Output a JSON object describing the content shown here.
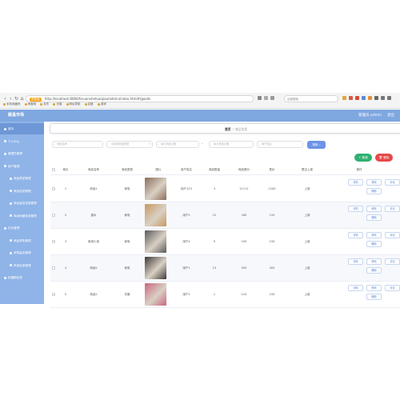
{
  "browser": {
    "url_badge": "不安全",
    "url": "http://localhost:8080/faruanshehuoqiao/admin/index.html#/goods",
    "search_placeholder": "百度搜索",
    "bookmarks": [
      "手机收藏夹",
      "淘宝网",
      "京东",
      "天猫",
      "网址导航",
      "百度",
      "游戏"
    ]
  },
  "app": {
    "title": "跳蚤市场",
    "admin_label": "管理员 admin",
    "logout_label": "退出"
  },
  "sidebar": {
    "items": [
      {
        "label": "首页",
        "active": true,
        "sub": false
      },
      {
        "label": "个人中心",
        "active": false,
        "sub": false
      },
      {
        "label": "管理员管理",
        "active": false,
        "sub": false
      },
      {
        "label": "用户管理",
        "active": false,
        "sub": false
      },
      {
        "label": "商品类型管理",
        "active": false,
        "sub": true
      },
      {
        "label": "商品信息管理",
        "active": false,
        "sub": true
      },
      {
        "label": "商品留言信息管理",
        "active": false,
        "sub": true
      },
      {
        "label": "商品收藏信息管理",
        "active": false,
        "sub": true
      },
      {
        "label": "论坛管理",
        "active": false,
        "sub": false
      },
      {
        "label": "商品求购管理",
        "active": false,
        "sub": true
      },
      {
        "label": "求购留言管理",
        "active": false,
        "sub": true
      },
      {
        "label": "系统信息管理",
        "active": false,
        "sub": true
      },
      {
        "label": "轮播图信息",
        "active": false,
        "sub": false
      }
    ]
  },
  "breadcrumb": {
    "home": "首页",
    "separator": "/",
    "current": "商品信息"
  },
  "filters": {
    "name_placeholder": "商品名称",
    "type_placeholder": "请选择商品类型",
    "price_min_placeholder": "最小商品价格",
    "range_separator": "-",
    "price_max_placeholder": "最大商品价格",
    "user_placeholder": "用户姓名",
    "search_label": "搜索"
  },
  "actions": {
    "add_label": "+ 新增",
    "delete_label": "删除"
  },
  "table": {
    "columns": [
      "索引",
      "商品名称",
      "商品类型",
      "图片",
      "用户姓名",
      "商品数量",
      "商品原价",
      "售价",
      "是否上架",
      "操作"
    ],
    "rows": [
      {
        "index": "1",
        "name": "商品1",
        "type": "家电",
        "user": "用户123",
        "qty": "3",
        "orig": "11111",
        "price": "1200",
        "status": "上架",
        "thumb": "#8a6d5a"
      },
      {
        "index": "2",
        "name": "香水",
        "type": "家电",
        "user": "用户2",
        "qty": "12",
        "orig": "180",
        "price": "120",
        "status": "上架",
        "thumb": "#c79a63"
      },
      {
        "index": "3",
        "name": "家用小电",
        "type": "家电",
        "user": "用户4",
        "qty": "9",
        "orig": "195",
        "price": "150",
        "status": "上架",
        "thumb": "#5a5a5a"
      },
      {
        "index": "4",
        "name": "商品2",
        "type": "家电",
        "user": "用户1",
        "qty": "13",
        "orig": "500",
        "price": "400",
        "status": "上架",
        "thumb": "#3f3a36"
      },
      {
        "index": "5",
        "name": "商品2",
        "type": "衣服",
        "user": "用户1",
        "qty": "1",
        "orig": "120",
        "price": "100",
        "status": "上架",
        "thumb": "#c9667d"
      }
    ],
    "row_actions": {
      "detail": "详情",
      "edit": "修改",
      "delete": "删除",
      "comment": "评论"
    }
  },
  "colors": {
    "header": "#7fa7e0",
    "sidebar": "#8fb4e8",
    "primary": "#6d93e8",
    "success": "#2fb170",
    "danger": "#e64848"
  }
}
